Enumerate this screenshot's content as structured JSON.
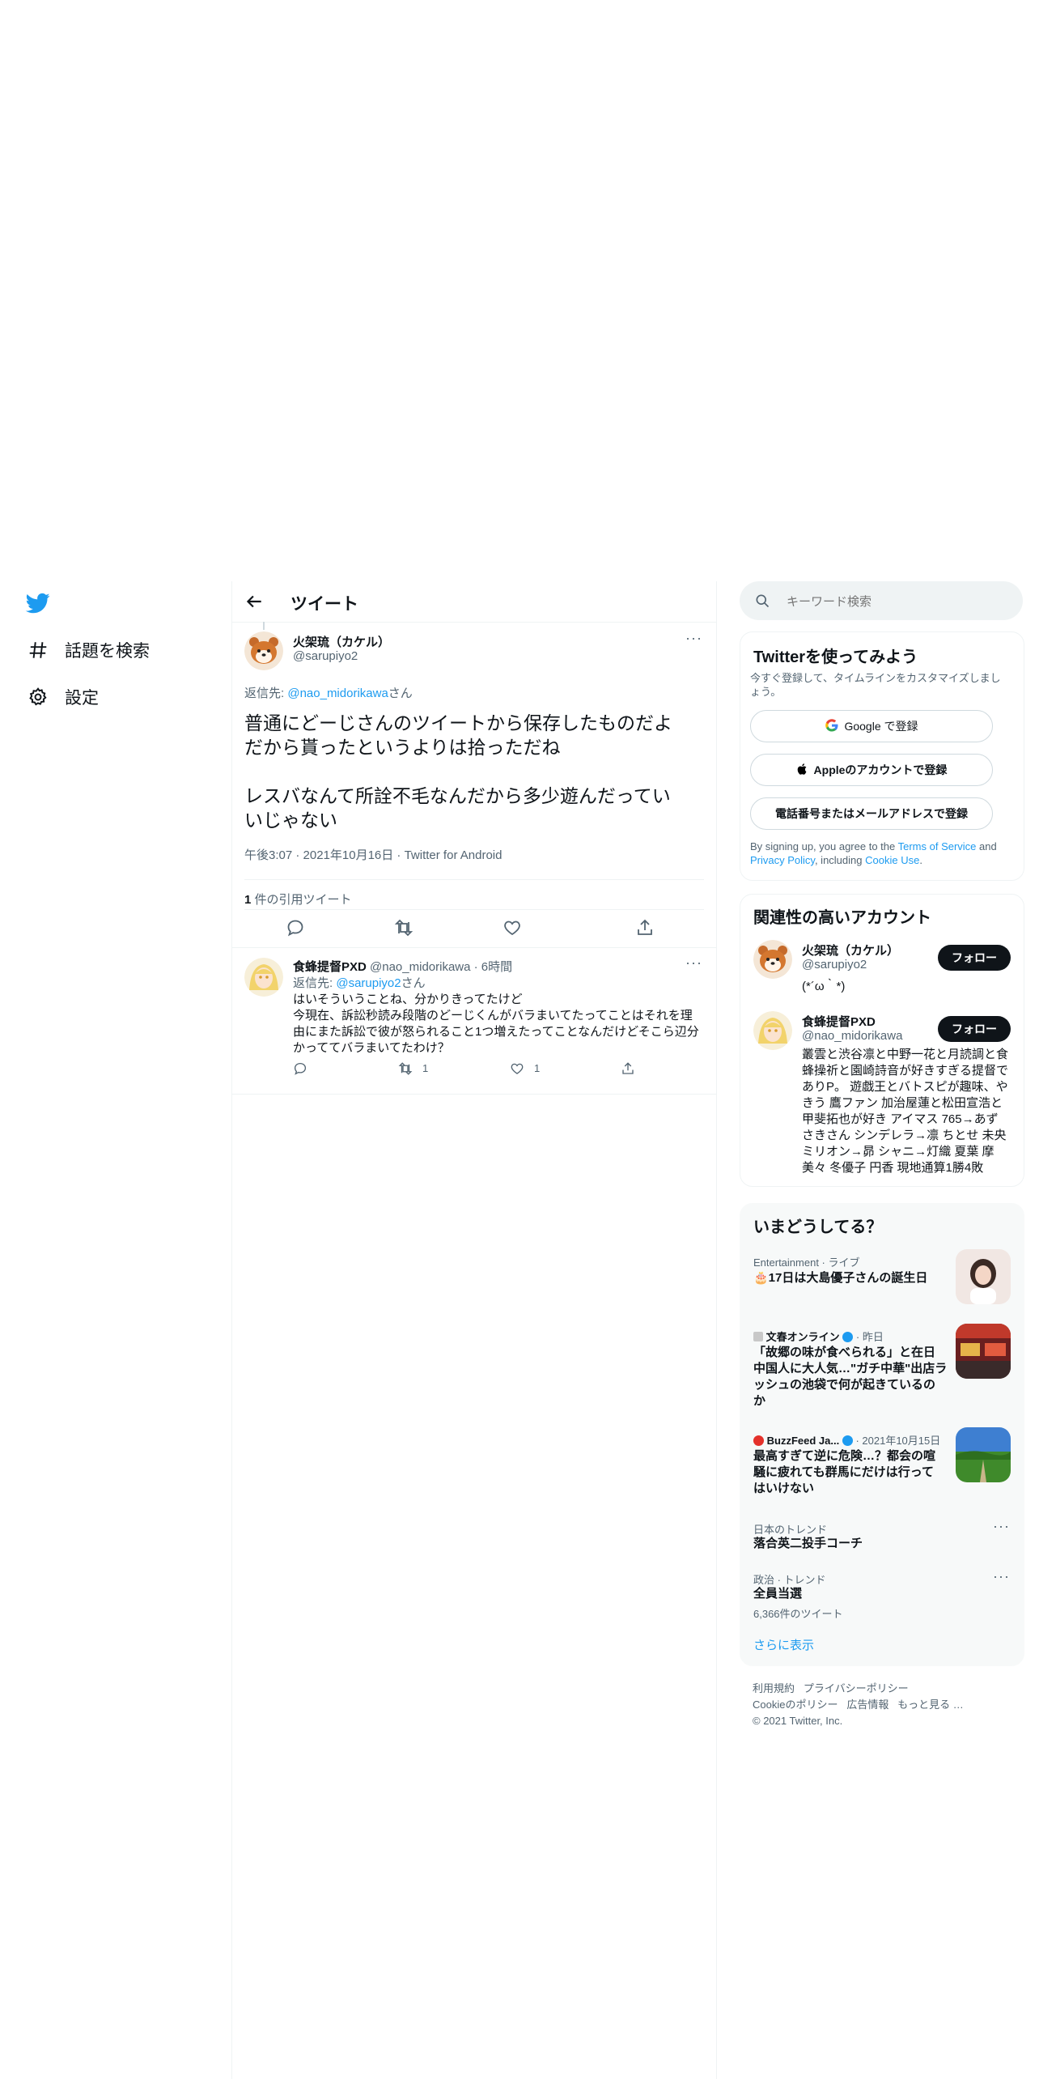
{
  "nav": {
    "items": [
      {
        "label": "話題を検索",
        "icon": "hash-icon"
      },
      {
        "label": "設定",
        "icon": "gear-icon"
      }
    ]
  },
  "header": {
    "title": "ツイート"
  },
  "main_tweet": {
    "author_name": "火架琉（カケル）",
    "author_handle": "@sarupiyo2",
    "reply_prefix": "返信先: ",
    "reply_to": "@nao_midorikawa",
    "reply_suffix": "さん",
    "text_line1": "普通にどーじさんのツイートから保存したものだよ",
    "text_line2": "だから貰ったというよりは拾っただね",
    "text_line3": "レスバなんて所詮不毛なんだから多少遊んだってい",
    "text_line4": "いじゃない",
    "meta": "午後3:07 · 2021年10月16日 · Twitter for Android",
    "quote_count": "1",
    "quote_label": " 件の引用ツイート"
  },
  "reply": {
    "author_name": "食蜂提督PXD",
    "author_handle": "@nao_midorikawa",
    "time": "· 6時間",
    "reply_prefix": "返信先: ",
    "reply_to": "@sarupiyo2",
    "reply_suffix": "さん",
    "text_line1": "はいそういうことね、分かりきってたけど",
    "text_line2": "今現在、訴訟秒読み段階のどーじくんがバラまいてたってことはそれを理",
    "text_line3": "由にまた訴訟で彼が怒られること1つ増えたってことなんだけどそこら辺分",
    "text_line4": "かっててバラまいてたわけ？",
    "retweets": "1",
    "likes": "1"
  },
  "search": {
    "placeholder": "キーワード検索"
  },
  "signup": {
    "title": "Twitterを使ってみよう",
    "subtitle_line1": "今すぐ登録して、タイムラインをカスタマイズしまし",
    "subtitle_line2": "ょう。",
    "google_label": "Google で登録",
    "apple_label": "Appleのアカウントで登録",
    "phone_label": "電話番号またはメールアドレスで登録",
    "legal_1": "By signing up, you agree to the ",
    "terms": "Terms of Service",
    "legal_2": " and",
    "privacy": "Privacy Policy",
    "legal_3": ", including ",
    "cookie": "Cookie Use",
    "legal_4": "."
  },
  "relevant": {
    "title": "関連性の高いアカウント",
    "follow_label": "フォロー",
    "accounts": [
      {
        "name": "火架琉（カケル）",
        "handle": "@sarupiyo2",
        "bio_lines": [
          "(*´ω｀*)"
        ]
      },
      {
        "name": "食蜂提督PXD",
        "handle": "@nao_midorikawa",
        "bio_lines": [
          "叢雲と渋谷凛と中野一花と月読調と食",
          "蜂操祈と園崎詩音が好きすぎる提督で",
          "ありP。 遊戯王とバトスピが趣味、や",
          "きう 鷹ファン 加治屋蓮と松田宣浩と",
          "甲斐拓也が好き アイマス 765→あず",
          "さきさん シンデレラ→凛 ちとせ 未央",
          "ミリオン→昴 シャニ→灯織 夏葉 摩",
          "美々 冬優子 円香 現地通算1勝4敗"
        ]
      }
    ]
  },
  "trends": {
    "title": "いまどうしてる？",
    "items": [
      {
        "meta": "Entertainment · ライブ",
        "title_lines": [
          "🎂17日は大島優子さんの誕生日"
        ]
      },
      {
        "source": "文春オンライン",
        "meta": "· 昨日",
        "title_lines": [
          "「故郷の味が食べられる」と在日",
          "中国人に大人気…\"ガチ中華\"出店ラ",
          "ッシュの池袋で何が起きているの",
          "か"
        ]
      },
      {
        "source": "BuzzFeed Ja...",
        "meta": "· 2021年10月15日",
        "title_lines": [
          "最高すぎて逆に危険…？都会の喧",
          "騒に疲れても群馬にだけは行って",
          "はいけない"
        ]
      },
      {
        "meta": "日本のトレンド",
        "title_lines": [
          "落合英二投手コーチ"
        ]
      },
      {
        "meta": "政治 · トレンド",
        "title_lines": [
          "全員当選"
        ],
        "count": "6,366件のツイート"
      }
    ],
    "show_more": "さらに表示"
  },
  "footer": {
    "line1": [
      "利用規約",
      "プライバシーポリシー"
    ],
    "line2": [
      "Cookieのポリシー",
      "広告情報",
      "もっと見る …"
    ],
    "copyright": "© 2021 Twitter, Inc."
  },
  "colors": {
    "accent": "#1d9bf0",
    "text": "#0f1419",
    "muted": "#536471",
    "border": "#eff3f4"
  }
}
